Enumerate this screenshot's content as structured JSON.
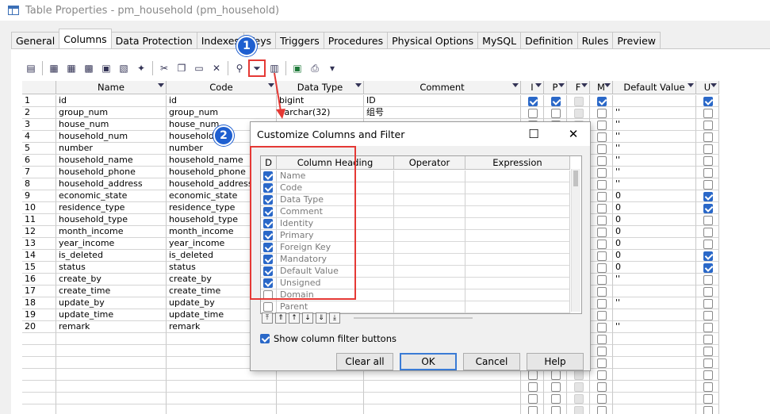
{
  "window": {
    "title": "Table Properties - pm_household (pm_household)"
  },
  "tabs": [
    "General",
    "Columns",
    "Data Protection",
    "Indexes",
    "Keys",
    "Triggers",
    "Procedures",
    "Physical Options",
    "MySQL",
    "Definition",
    "Rules",
    "Preview"
  ],
  "active_tab": "Columns",
  "toolbar_icons": [
    "properties-icon",
    "insert-row-icon",
    "add-row-icon",
    "add-columns-icon",
    "replace-icon",
    "wizard-icon",
    "cut-icon",
    "copy-icon",
    "paste-icon",
    "delete-icon",
    "find-icon",
    "customize-filter-icon",
    "filter-on-icon",
    "excel-export-icon",
    "print-icon",
    "dropdown-icon"
  ],
  "grid": {
    "headers": {
      "name": "Name",
      "code": "Code",
      "datatype": "Data Type",
      "comment": "Comment",
      "i": "I",
      "p": "P",
      "f": "F",
      "m": "M",
      "default": "Default Value",
      "u": "U"
    },
    "rows": [
      {
        "num": "1",
        "name": "id",
        "code": "id",
        "datatype": "bigint",
        "comment": "ID",
        "i": true,
        "p": true,
        "m": true,
        "default": "",
        "u": true
      },
      {
        "num": "2",
        "name": "group_num",
        "code": "group_num",
        "datatype": "varchar(32)",
        "comment": "组号",
        "i": false,
        "p": false,
        "m": false,
        "default": "''",
        "u": false
      },
      {
        "num": "3",
        "name": "house_num",
        "code": "house_num",
        "datatype": "",
        "comment": "",
        "i": false,
        "p": false,
        "m": false,
        "default": "''",
        "u": false
      },
      {
        "num": "4",
        "name": "household_num",
        "code": "household_",
        "datatype": "",
        "comment": "",
        "i": false,
        "p": false,
        "m": false,
        "default": "''",
        "u": false
      },
      {
        "num": "5",
        "name": "number",
        "code": "number",
        "datatype": "",
        "comment": "",
        "i": false,
        "p": false,
        "m": false,
        "default": "''",
        "u": false
      },
      {
        "num": "6",
        "name": "household_name",
        "code": "household_name",
        "datatype": "",
        "comment": "",
        "i": false,
        "p": false,
        "m": false,
        "default": "''",
        "u": false
      },
      {
        "num": "7",
        "name": "household_phone",
        "code": "household_phone",
        "datatype": "",
        "comment": "",
        "i": false,
        "p": false,
        "m": false,
        "default": "''",
        "u": false
      },
      {
        "num": "8",
        "name": "household_address",
        "code": "household_address",
        "datatype": "",
        "comment": "",
        "i": false,
        "p": false,
        "m": false,
        "default": "''",
        "u": false
      },
      {
        "num": "9",
        "name": "economic_state",
        "code": "economic_state",
        "datatype": "",
        "comment": "",
        "i": false,
        "p": false,
        "m": false,
        "default": "0",
        "u": true
      },
      {
        "num": "10",
        "name": "residence_type",
        "code": "residence_type",
        "datatype": "",
        "comment": "",
        "i": false,
        "p": false,
        "m": false,
        "default": "0",
        "u": true
      },
      {
        "num": "11",
        "name": "household_type",
        "code": "household_type",
        "datatype": "",
        "comment": "",
        "i": false,
        "p": false,
        "m": false,
        "default": "0",
        "u": false
      },
      {
        "num": "12",
        "name": "month_income",
        "code": "month_income",
        "datatype": "",
        "comment": "",
        "i": false,
        "p": false,
        "m": false,
        "default": "0",
        "u": false
      },
      {
        "num": "13",
        "name": "year_income",
        "code": "year_income",
        "datatype": "",
        "comment": "",
        "i": false,
        "p": false,
        "m": false,
        "default": "0",
        "u": false
      },
      {
        "num": "14",
        "name": "is_deleted",
        "code": "is_deleted",
        "datatype": "",
        "comment": "",
        "i": false,
        "p": false,
        "m": false,
        "default": "0",
        "u": true
      },
      {
        "num": "15",
        "name": "status",
        "code": "status",
        "datatype": "",
        "comment": "",
        "i": false,
        "p": false,
        "m": false,
        "default": "0",
        "u": true
      },
      {
        "num": "16",
        "name": "create_by",
        "code": "create_by",
        "datatype": "",
        "comment": "",
        "i": false,
        "p": false,
        "m": false,
        "default": "''",
        "u": false
      },
      {
        "num": "17",
        "name": "create_time",
        "code": "create_time",
        "datatype": "",
        "comment": "",
        "i": false,
        "p": false,
        "m": false,
        "default": "",
        "u": false
      },
      {
        "num": "18",
        "name": "update_by",
        "code": "update_by",
        "datatype": "",
        "comment": "",
        "i": false,
        "p": false,
        "m": false,
        "default": "''",
        "u": false
      },
      {
        "num": "19",
        "name": "update_time",
        "code": "update_time",
        "datatype": "",
        "comment": "",
        "i": false,
        "p": false,
        "m": false,
        "default": "",
        "u": false
      },
      {
        "num": "20",
        "name": "remark",
        "code": "remark",
        "datatype": "",
        "comment": "",
        "i": false,
        "p": false,
        "m": false,
        "default": "''",
        "u": false
      }
    ]
  },
  "badges": {
    "one": "1",
    "two": "2"
  },
  "dialog": {
    "title": "Customize Columns and Filter",
    "headers": {
      "d": "D",
      "heading": "Column Heading",
      "operator": "Operator",
      "expression": "Expression"
    },
    "columns": [
      {
        "label": "Name",
        "checked": true
      },
      {
        "label": "Code",
        "checked": true
      },
      {
        "label": "Data Type",
        "checked": true
      },
      {
        "label": "Comment",
        "checked": true
      },
      {
        "label": "Identity",
        "checked": true
      },
      {
        "label": "Primary",
        "checked": true
      },
      {
        "label": "Foreign Key",
        "checked": true
      },
      {
        "label": "Mandatory",
        "checked": true
      },
      {
        "label": "Default Value",
        "checked": true
      },
      {
        "label": "Unsigned",
        "checked": true
      },
      {
        "label": "Domain",
        "checked": false
      },
      {
        "label": "Parent",
        "checked": false
      }
    ],
    "move_buttons": [
      "⤒",
      "⇑",
      "↑",
      "↓",
      "⇓",
      "⤓"
    ],
    "show_filter_label": "Show column filter buttons",
    "show_filter_checked": true,
    "buttons": {
      "clear": "Clear all",
      "ok": "OK",
      "cancel": "Cancel",
      "help": "Help"
    }
  },
  "colors": {
    "accent": "#2a68c8",
    "highlight": "#e53935",
    "badge": "#1e5fd0"
  }
}
